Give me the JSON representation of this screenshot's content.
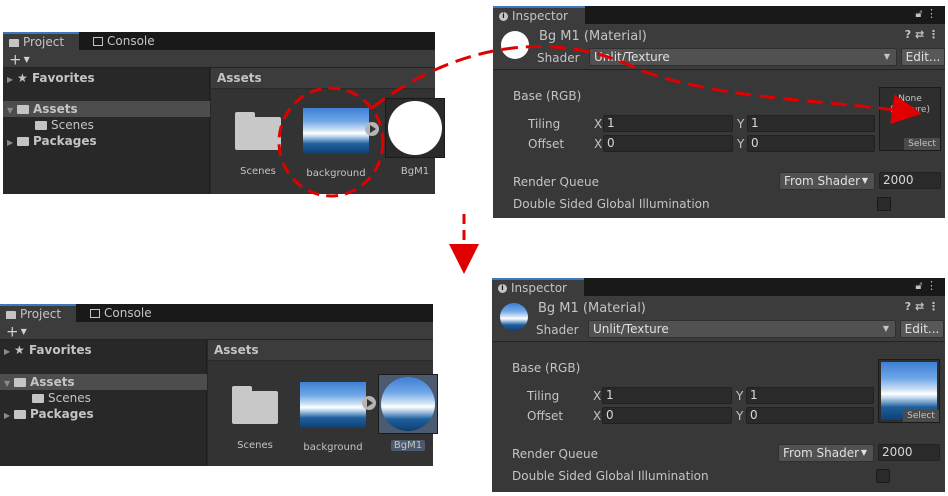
{
  "before": {
    "project": {
      "tabs": [
        "Project",
        "Console"
      ],
      "add_label": "+",
      "tree": {
        "favorites": "Favorites",
        "assets": "Assets",
        "scenes": "Scenes",
        "packages": "Packages"
      },
      "assets_header": "Assets",
      "items": [
        "Scenes",
        "background",
        "BgM1"
      ]
    },
    "inspector": {
      "tab": "Inspector",
      "title": "Bg M1 (Material)",
      "shader_label": "Shader",
      "shader_value": "Unlit/Texture",
      "edit_label": "Edit...",
      "base_label": "Base (RGB)",
      "tiling_label": "Tiling",
      "offset_label": "Offset",
      "x_axis": "X",
      "y_axis": "Y",
      "tiling_x": "1",
      "tiling_y": "1",
      "offset_x": "0",
      "offset_y": "0",
      "texture_none": "None\n(Texture)",
      "select_label": "Select",
      "render_queue_label": "Render Queue",
      "render_queue_mode": "From Shader",
      "render_queue_value": "2000",
      "dsgi_label": "Double Sided Global Illumination"
    }
  },
  "after": {
    "project": {
      "tabs": [
        "Project",
        "Console"
      ],
      "add_label": "+",
      "tree": {
        "favorites": "Favorites",
        "assets": "Assets",
        "scenes": "Scenes",
        "packages": "Packages"
      },
      "assets_header": "Assets",
      "items": [
        "Scenes",
        "background",
        "BgM1"
      ]
    },
    "inspector": {
      "tab": "Inspector",
      "title": "Bg M1 (Material)",
      "shader_label": "Shader",
      "shader_value": "Unlit/Texture",
      "edit_label": "Edit...",
      "base_label": "Base (RGB)",
      "tiling_label": "Tiling",
      "offset_label": "Offset",
      "x_axis": "X",
      "y_axis": "Y",
      "tiling_x": "1",
      "tiling_y": "1",
      "offset_x": "0",
      "offset_y": "0",
      "select_label": "Select",
      "render_queue_label": "Render Queue",
      "render_queue_mode": "From Shader",
      "render_queue_value": "2000",
      "dsgi_label": "Double Sided Global Illumination"
    }
  },
  "colors": {
    "annotation_red": "#e00000",
    "panel_bg": "#282828",
    "selection": "#4d5a6d"
  }
}
